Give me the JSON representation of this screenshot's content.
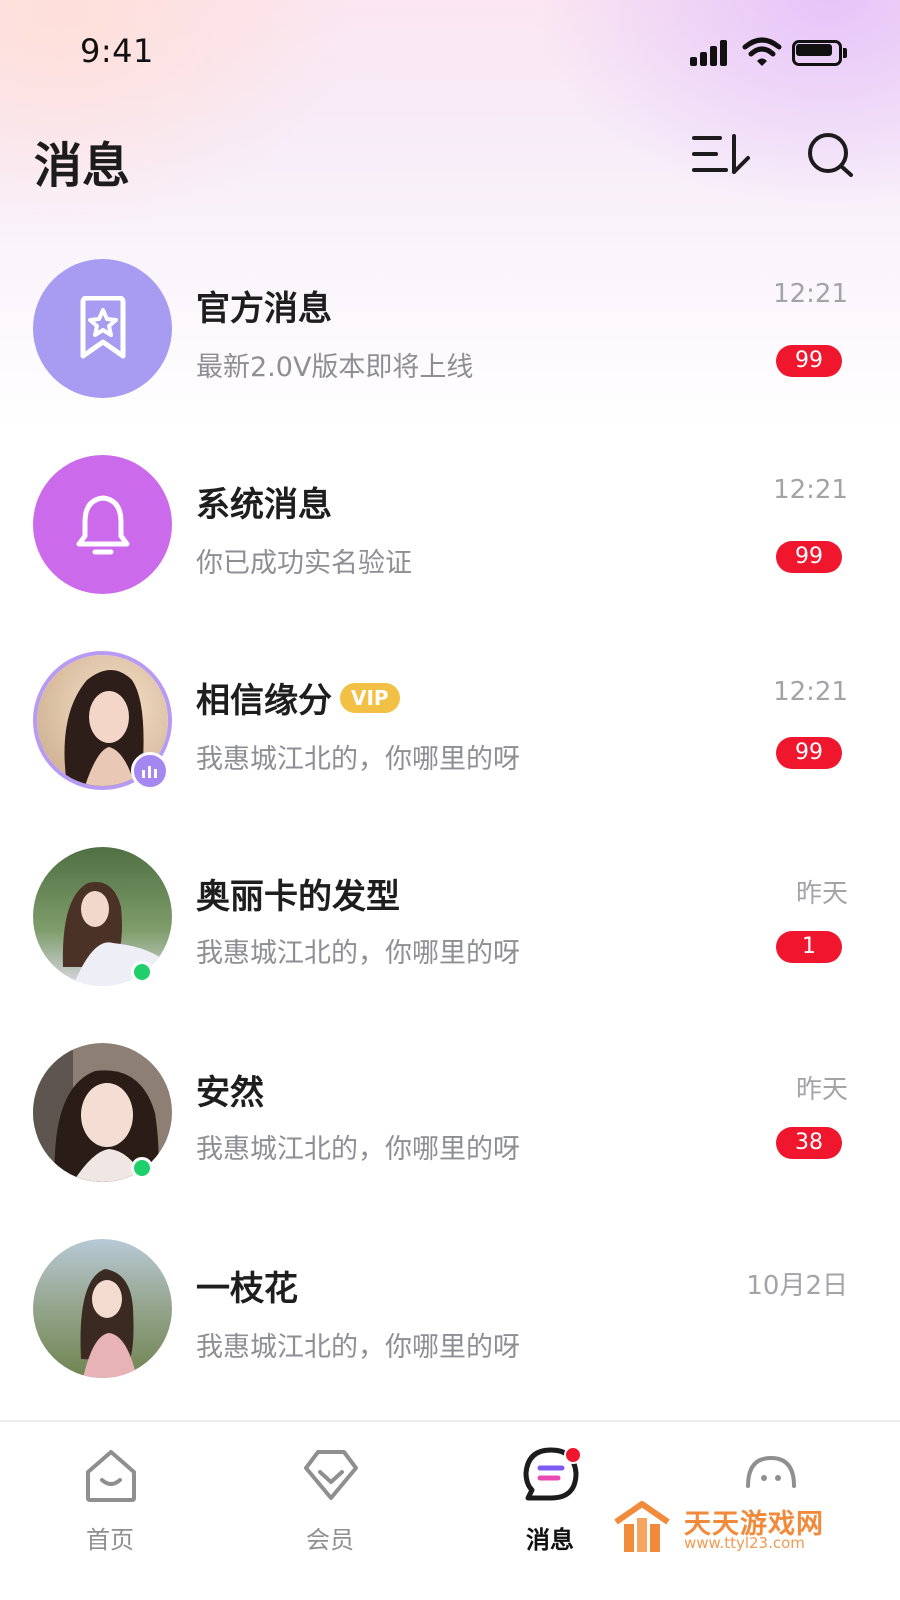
{
  "status_bar": {
    "time": "9:41"
  },
  "header": {
    "title": "消息"
  },
  "conversations": [
    {
      "name": "官方消息",
      "preview": "最新2.0V版本即将上线",
      "time": "12:21",
      "unread": "99"
    },
    {
      "name": "系统消息",
      "preview": "你已成功实名验证",
      "time": "12:21",
      "unread": "99"
    },
    {
      "name": "相信缘分",
      "vip": "VIP",
      "preview": "我惠城江北的，你哪里的呀",
      "time": "12:21",
      "unread": "99"
    },
    {
      "name": "奥丽卡的发型",
      "preview": "我惠城江北的，你哪里的呀",
      "time": "昨天",
      "unread": "1"
    },
    {
      "name": "安然",
      "preview": "我惠城江北的，你哪里的呀",
      "time": "昨天",
      "unread": "38"
    },
    {
      "name": "一枝花",
      "preview": "我惠城江北的，你哪里的呀",
      "time": "10月2日"
    }
  ],
  "tabbar": {
    "tabs": [
      {
        "label": "首页",
        "icon": "home-icon"
      },
      {
        "label": "会员",
        "icon": "diamond-icon"
      },
      {
        "label": "消息",
        "icon": "message-icon",
        "active": true
      },
      {
        "label": "",
        "icon": "profile-icon"
      }
    ]
  },
  "watermark": {
    "text": "天天游戏网",
    "url": "www.ttyl23.com"
  },
  "colors": {
    "badge": "#f0162e",
    "online": "#1fcf6b",
    "vip": "#f3c046",
    "official": "#a89bf2",
    "system": "#cc6aec"
  }
}
